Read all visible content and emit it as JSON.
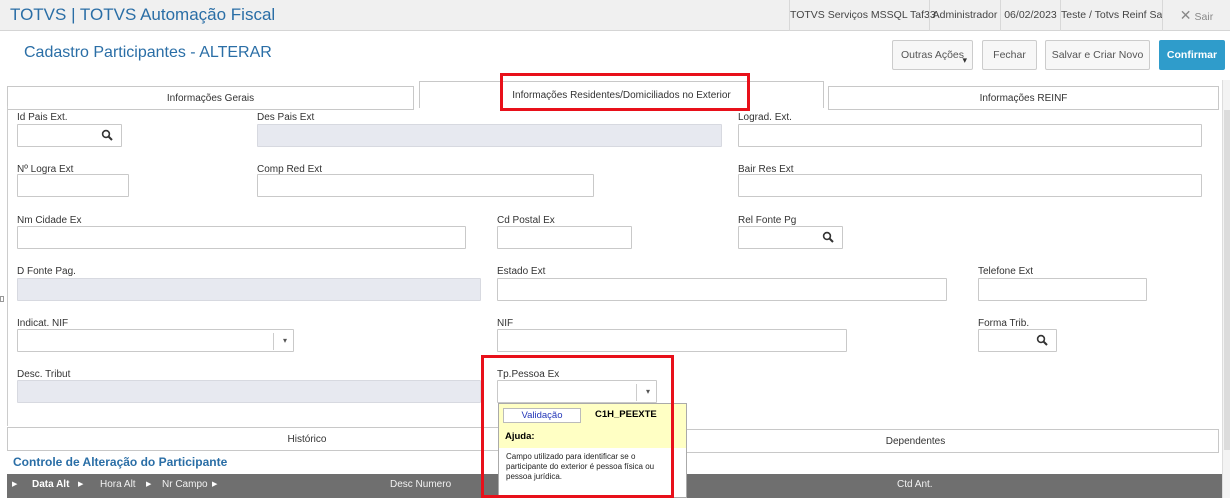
{
  "app": {
    "title": "TOTVS | TOTVS Automação Fiscal",
    "server": "TOTVS Serviços MSSQL Taf33",
    "user": "Administrador",
    "date": "06/02/2023",
    "company": "Teste / Totvs Reinf Sa",
    "exit_label": "Sair",
    "exit_icon": "✕"
  },
  "header": {
    "title": "Cadastro Participantes - ALTERAR",
    "actions": {
      "more": "Outras Ações",
      "close": "Fechar",
      "save_new": "Salvar e Criar Novo",
      "confirm": "Confirmar"
    },
    "caret": "▾"
  },
  "tabs": [
    "Informações Gerais",
    "Informações Residentes/Domiciliados no Exterior",
    "Informações REINF"
  ],
  "fields": {
    "id_pais_ext": {
      "label": "Id Pais Ext.",
      "value": ""
    },
    "des_pais_ext": {
      "label": "Des Pais Ext",
      "value": ""
    },
    "lograd_ext": {
      "label": "Lograd. Ext.",
      "value": ""
    },
    "n_logra_ext": {
      "label": "Nº Logra Ext",
      "value": ""
    },
    "comp_red_ext": {
      "label": "Comp Red Ext",
      "value": ""
    },
    "bair_res_ext": {
      "label": "Bair Res Ext",
      "value": ""
    },
    "nm_cidade_ex": {
      "label": "Nm Cidade Ex",
      "value": ""
    },
    "cd_postal_ex": {
      "label": "Cd Postal Ex",
      "value": ""
    },
    "rel_fonte_pg": {
      "label": "Rel Fonte Pg",
      "value": ""
    },
    "d_fonte_pag": {
      "label": "D Fonte Pag.",
      "value": ""
    },
    "estado_ext": {
      "label": "Estado Ext",
      "value": ""
    },
    "telefone_ext": {
      "label": "Telefone Ext",
      "value": ""
    },
    "indicat_nif": {
      "label": "Indicat. NIF",
      "value": ""
    },
    "nif": {
      "label": "NIF",
      "value": ""
    },
    "forma_trib": {
      "label": "Forma Trib.",
      "value": ""
    },
    "desc_tribut": {
      "label": "Desc. Tribut",
      "value": ""
    },
    "tp_pessoa_ex": {
      "label": "Tp.Pessoa Ex",
      "value": ""
    }
  },
  "tooltip": {
    "tab": "Validação",
    "code": "C1H_PEEXTE",
    "heading": "Ajuda:",
    "text": "Campo utilizado para identificar se o participante do exterior é pessoa física ou pessoa jurídica."
  },
  "lower_tabs": [
    "Histórico",
    "Dependentes"
  ],
  "section": {
    "title": "Controle de Alteração do Participante"
  },
  "grid": {
    "columns": [
      "Data Alt",
      "Hora Alt",
      "Nr Campo",
      "Desc Numero",
      "Ctd Ant."
    ]
  },
  "colors": {
    "accent": "#2a6ea6",
    "primary_button": "#2f9ccb",
    "highlight": "#e8101a",
    "tooltip_bg": "#ffffc4"
  }
}
